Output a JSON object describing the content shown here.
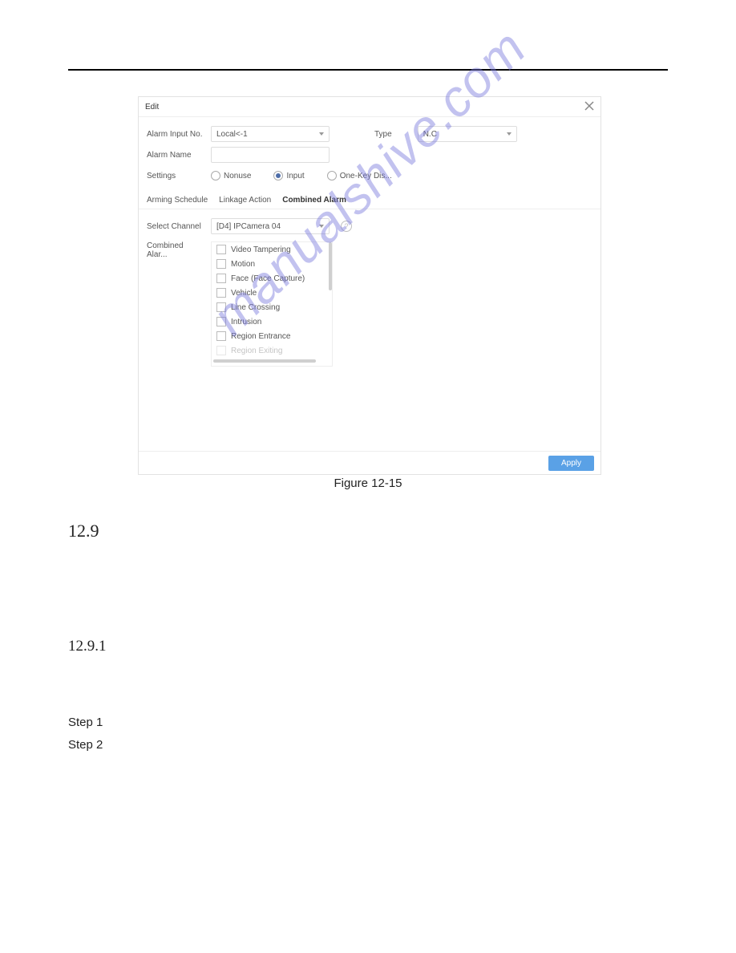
{
  "dialog": {
    "title": "Edit",
    "close_label": "×",
    "apply_label": "Apply",
    "fields": {
      "alarm_input_no": {
        "label": "Alarm Input No.",
        "value": "Local<-1"
      },
      "type": {
        "label": "Type",
        "value": "N.C"
      },
      "alarm_name": {
        "label": "Alarm Name",
        "value": ""
      },
      "settings_label": "Settings",
      "settings_options": {
        "nonuse": "Nonuse",
        "input": "Input",
        "onekey": "One-Key Dis..."
      }
    },
    "tabs": {
      "arming": "Arming Schedule",
      "linkage": "Linkage Action",
      "combined": "Combined Alarm"
    },
    "combined": {
      "select_channel_label": "Select Channel",
      "select_channel_value": "[D4] IPCamera 04",
      "help": "?",
      "list_label": "Combined Alar...",
      "items": [
        "Video Tampering",
        "Motion",
        "Face (Face Capture)",
        "Vehicle",
        "Line Crossing",
        "Intrusion",
        "Region Entrance",
        "Region Exiting"
      ]
    }
  },
  "watermark": "manualshive.com",
  "figure_caption": "Figure 12-15",
  "section_number": "12.9",
  "subsection_number": "12.9.1",
  "steps": {
    "s1": "Step 1",
    "s2": "Step 2"
  }
}
